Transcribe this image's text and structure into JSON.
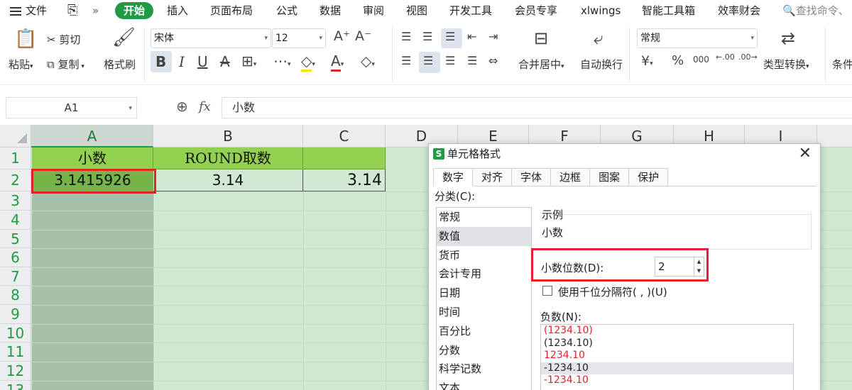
{
  "menu": {
    "file": "文件",
    "tabs": [
      "开始",
      "插入",
      "页面布局",
      "公式",
      "数据",
      "审阅",
      "视图",
      "开发工具",
      "会员专享",
      "xlwings",
      "智能工具箱",
      "效率财会"
    ],
    "active": "开始",
    "search": "查找命令、"
  },
  "ribbon": {
    "paste": "粘贴",
    "cut": "剪切",
    "copy": "复制",
    "format_painter": "格式刷",
    "font_name": "宋体",
    "font_size": "12",
    "merge_center": "合并居中",
    "wrap_text": "自动换行",
    "number_format": "常规",
    "type_convert": "类型转换",
    "conditional": "条件",
    "percent": "%",
    "thousands": "000",
    "inc_decimal": ".00",
    "dec_decimal": ".00"
  },
  "formula": {
    "name_box": "A1",
    "content": "小数"
  },
  "sheet": {
    "columns": [
      "A",
      "B",
      "C",
      "D",
      "E",
      "F",
      "G",
      "H",
      "I"
    ],
    "rows": [
      "1",
      "2",
      "3",
      "4",
      "5",
      "6",
      "7",
      "8",
      "9",
      "10",
      "11",
      "12",
      "13"
    ],
    "a1": "小数",
    "b1": "ROUND取数",
    "a2": "3.1415926",
    "b2": "3.14",
    "c2": "3.14"
  },
  "dialog": {
    "title": "单元格格式",
    "tabs": [
      "数字",
      "对齐",
      "字体",
      "边框",
      "图案",
      "保护"
    ],
    "category_label": "分类(C):",
    "categories": [
      "常规",
      "数值",
      "货币",
      "会计专用",
      "日期",
      "时间",
      "百分比",
      "分数",
      "科学记数",
      "文本"
    ],
    "selected_category": "数值",
    "sample_label": "示例",
    "sample_value": "小数",
    "decimal_label": "小数位数(D):",
    "decimal_value": "2",
    "thousands_label": "使用千位分隔符( , )(U)",
    "negative_label": "负数(N):",
    "negatives": [
      "(1234.10)",
      "(1234.10)",
      "1234.10",
      "-1234.10",
      "-1234.10"
    ]
  }
}
